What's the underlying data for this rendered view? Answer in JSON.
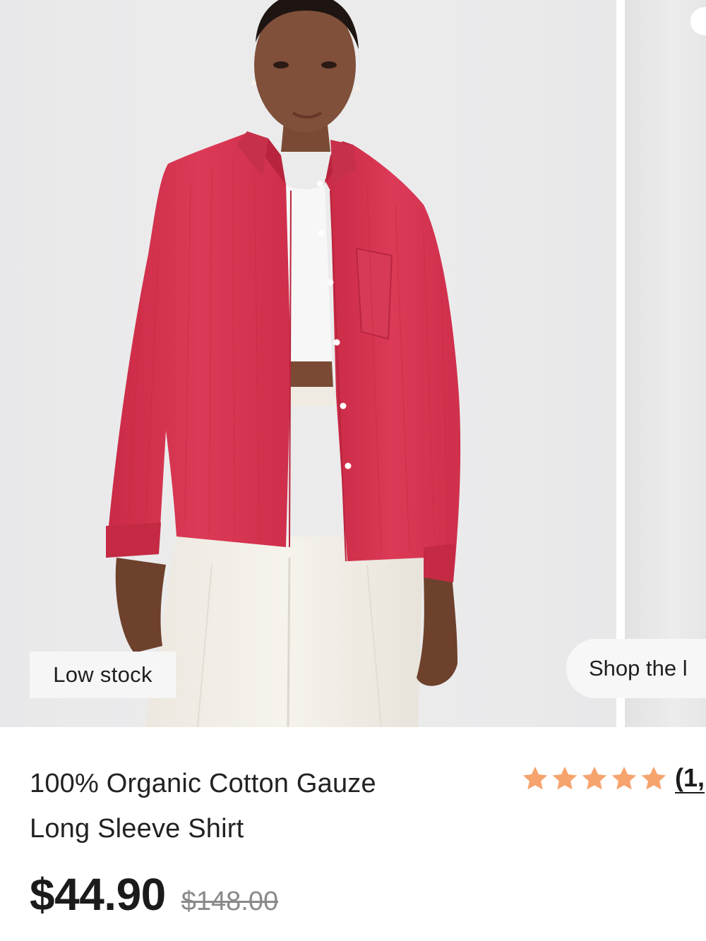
{
  "product_image": {
    "badge": "Low stock",
    "shop_look_label": "Shop the l"
  },
  "product": {
    "title_line1": "100% Organic Cotton Gauze",
    "title_line2": "Long Sleeve Shirt",
    "rating_stars": 5,
    "review_count": "(1,",
    "price": "$44.90",
    "original_price": "$148.00"
  },
  "colors": {
    "star": "#F6A36E",
    "shirt": "#D9334F",
    "background": "#EBEBEC"
  },
  "icons": {
    "star": "star-icon"
  }
}
